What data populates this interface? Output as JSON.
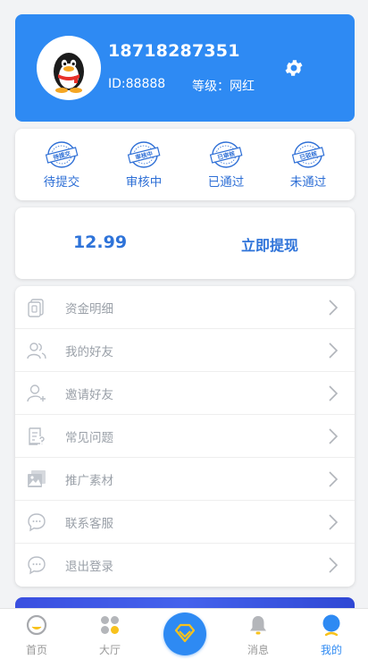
{
  "profile": {
    "phone": "18718287351",
    "id_text": "ID:88888",
    "level_text": "等级：网红"
  },
  "status": {
    "items": [
      {
        "label": "待提交",
        "stamp": "待提交",
        "icon": "stamp-pending-submit-icon"
      },
      {
        "label": "审核中",
        "stamp": "审核中",
        "icon": "stamp-reviewing-icon"
      },
      {
        "label": "已通过",
        "stamp": "已审核",
        "icon": "stamp-approved-icon"
      },
      {
        "label": "未通过",
        "stamp": "已驳核",
        "icon": "stamp-rejected-icon"
      }
    ]
  },
  "balance": {
    "amount": "12.99",
    "withdraw_label": "立即提现"
  },
  "menu": {
    "items": [
      {
        "label": "资金明细",
        "icon": "wallet-detail-icon"
      },
      {
        "label": "我的好友",
        "icon": "friends-icon"
      },
      {
        "label": "邀请好友",
        "icon": "invite-user-icon"
      },
      {
        "label": "常见问题",
        "icon": "faq-document-icon"
      },
      {
        "label": "推广素材",
        "icon": "image-gallery-icon"
      },
      {
        "label": "联系客服",
        "icon": "chat-bubble-icon"
      },
      {
        "label": "退出登录",
        "icon": "chat-bubble-icon"
      }
    ]
  },
  "tabbar": {
    "items": [
      {
        "label": "首页",
        "icon": "home-face-icon"
      },
      {
        "label": "大厅",
        "icon": "hall-dots-icon"
      },
      {
        "label": "",
        "icon": "diamond-icon"
      },
      {
        "label": "消息",
        "icon": "bell-icon"
      },
      {
        "label": "我的",
        "icon": "user-icon"
      }
    ]
  },
  "colors": {
    "primary": "#2e8af3",
    "text_blue": "#2e73d9",
    "menu_text": "#9aa0a8",
    "accent_yellow": "#f8c21c"
  }
}
